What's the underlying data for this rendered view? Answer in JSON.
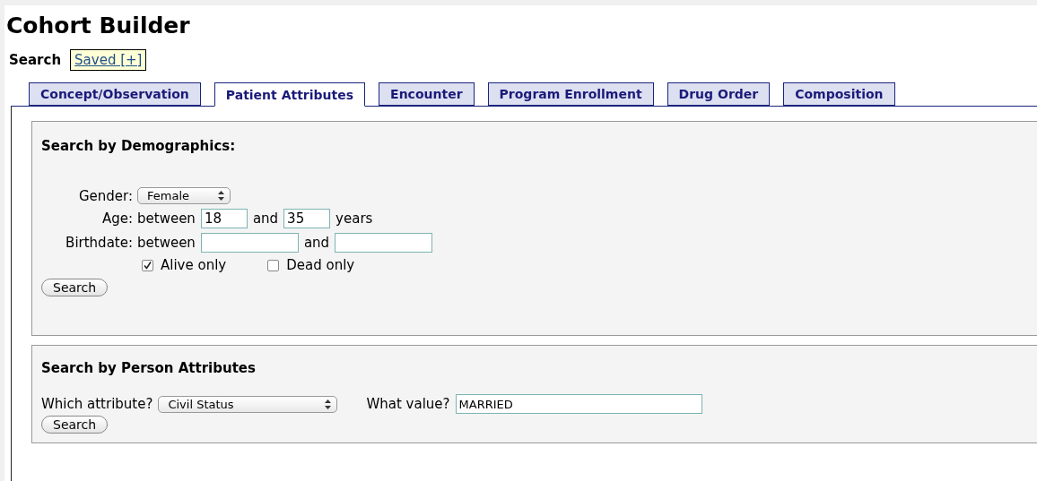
{
  "title": "Cohort Builder",
  "search_bar": {
    "label": "Search",
    "saved_link": "Saved [+]"
  },
  "tabs": [
    {
      "label": "Concept/Observation",
      "selected": false
    },
    {
      "label": "Patient Attributes",
      "selected": true
    },
    {
      "label": "Encounter",
      "selected": false
    },
    {
      "label": "Program Enrollment",
      "selected": false
    },
    {
      "label": "Drug Order",
      "selected": false
    },
    {
      "label": "Composition",
      "selected": false
    }
  ],
  "demographics": {
    "heading": "Search by Demographics:",
    "gender": {
      "label": "Gender:",
      "value": "Female"
    },
    "age": {
      "label": "Age:",
      "between": "between",
      "from": "18",
      "and": "and",
      "to": "35",
      "unit": "years"
    },
    "birthdate": {
      "label": "Birthdate:",
      "between": "between",
      "and": "and"
    },
    "options": [
      {
        "label": "Alive only",
        "checked": true
      },
      {
        "label": "Dead only",
        "checked": false
      }
    ],
    "button": "Search"
  },
  "person_attributes": {
    "heading": "Search by Person Attributes",
    "attribute_label": "Which attribute?",
    "attribute_value": "Civil Status",
    "value_label": "What value?",
    "value": "MARRIED",
    "button": "Search"
  }
}
